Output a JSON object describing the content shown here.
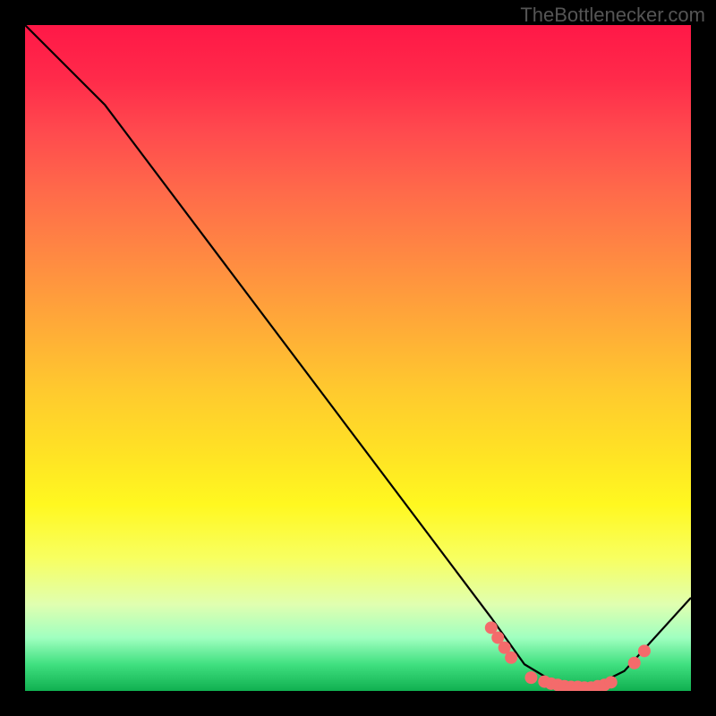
{
  "watermark": "TheBottlenecker.com",
  "chart_data": {
    "type": "line",
    "title": "",
    "xlabel": "",
    "ylabel": "",
    "xlim": [
      0,
      100
    ],
    "ylim": [
      0,
      100
    ],
    "grid": false,
    "line": {
      "points_xy": [
        [
          0,
          100
        ],
        [
          8,
          92
        ],
        [
          12,
          88
        ],
        [
          70,
          11
        ],
        [
          75,
          4
        ],
        [
          80,
          1
        ],
        [
          85,
          0.5
        ],
        [
          90,
          3
        ],
        [
          100,
          14
        ]
      ],
      "color": "#000000"
    },
    "markers": {
      "points_xy": [
        [
          70,
          9.5
        ],
        [
          71,
          8.0
        ],
        [
          72,
          6.5
        ],
        [
          73,
          5.0
        ],
        [
          76,
          2.0
        ],
        [
          78,
          1.4
        ],
        [
          79,
          1.1
        ],
        [
          80,
          0.9
        ],
        [
          81,
          0.7
        ],
        [
          82,
          0.6
        ],
        [
          83,
          0.6
        ],
        [
          84,
          0.5
        ],
        [
          85,
          0.5
        ],
        [
          86,
          0.7
        ],
        [
          87,
          0.9
        ],
        [
          88,
          1.3
        ],
        [
          91.5,
          4.2
        ],
        [
          93,
          6.0
        ]
      ],
      "color": "#f46b6b",
      "size": 7
    },
    "background_gradient": {
      "top": "#ff1847",
      "mid": "#ffe424",
      "bottom": "#10b050"
    }
  }
}
